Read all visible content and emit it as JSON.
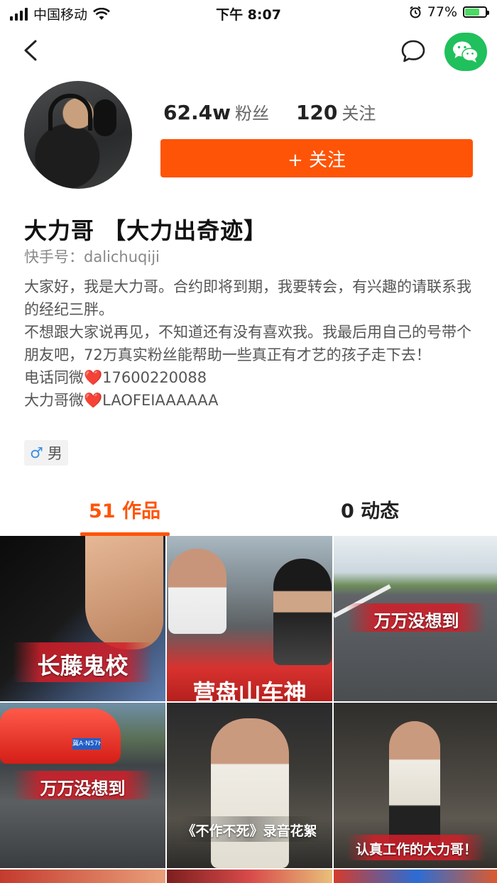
{
  "status_bar": {
    "carrier": "中国移动",
    "time": "下午 8:07",
    "battery": "77%",
    "battery_level": 0.77
  },
  "profile": {
    "followers_count": "62.4w",
    "followers_label": "粉丝",
    "following_count": "120",
    "following_label": "关注",
    "follow_button": "+ 关注",
    "name": "大力哥 【大力出奇迹】",
    "kwai_id": "快手号：dalichuqiji",
    "bio": [
      "大家好，我是大力哥。合约即将到期，我要转会，有兴趣的请联系我的经纪三胖。",
      "不想跟大家说再见，不知道还有没有喜欢我。我最后用自己的号带个朋友吧，72万真实粉丝能帮助一些真正有才艺的孩子走下去！"
    ],
    "phone_label": "电话同微",
    "phone": "17600220088",
    "wechat_label": "大力哥微",
    "wechat": "LAOFEIAAAAAA",
    "gender_symbol": "♂",
    "gender": "男"
  },
  "tabs": [
    {
      "label": "51 作品",
      "active": true
    },
    {
      "label": "0 动态",
      "active": false
    }
  ],
  "videos": [
    {
      "caption": "长藤鬼校"
    },
    {
      "caption": "营盘山车神"
    },
    {
      "caption": "万万没想到"
    },
    {
      "caption": "万万没想到",
      "plate": "冀A·N57H9"
    },
    {
      "caption": "《不作不死》录音花絮"
    },
    {
      "caption": "认真工作的大力哥！"
    }
  ],
  "colors": {
    "accent": "#fe5407",
    "wechat_green": "#20c05c"
  }
}
